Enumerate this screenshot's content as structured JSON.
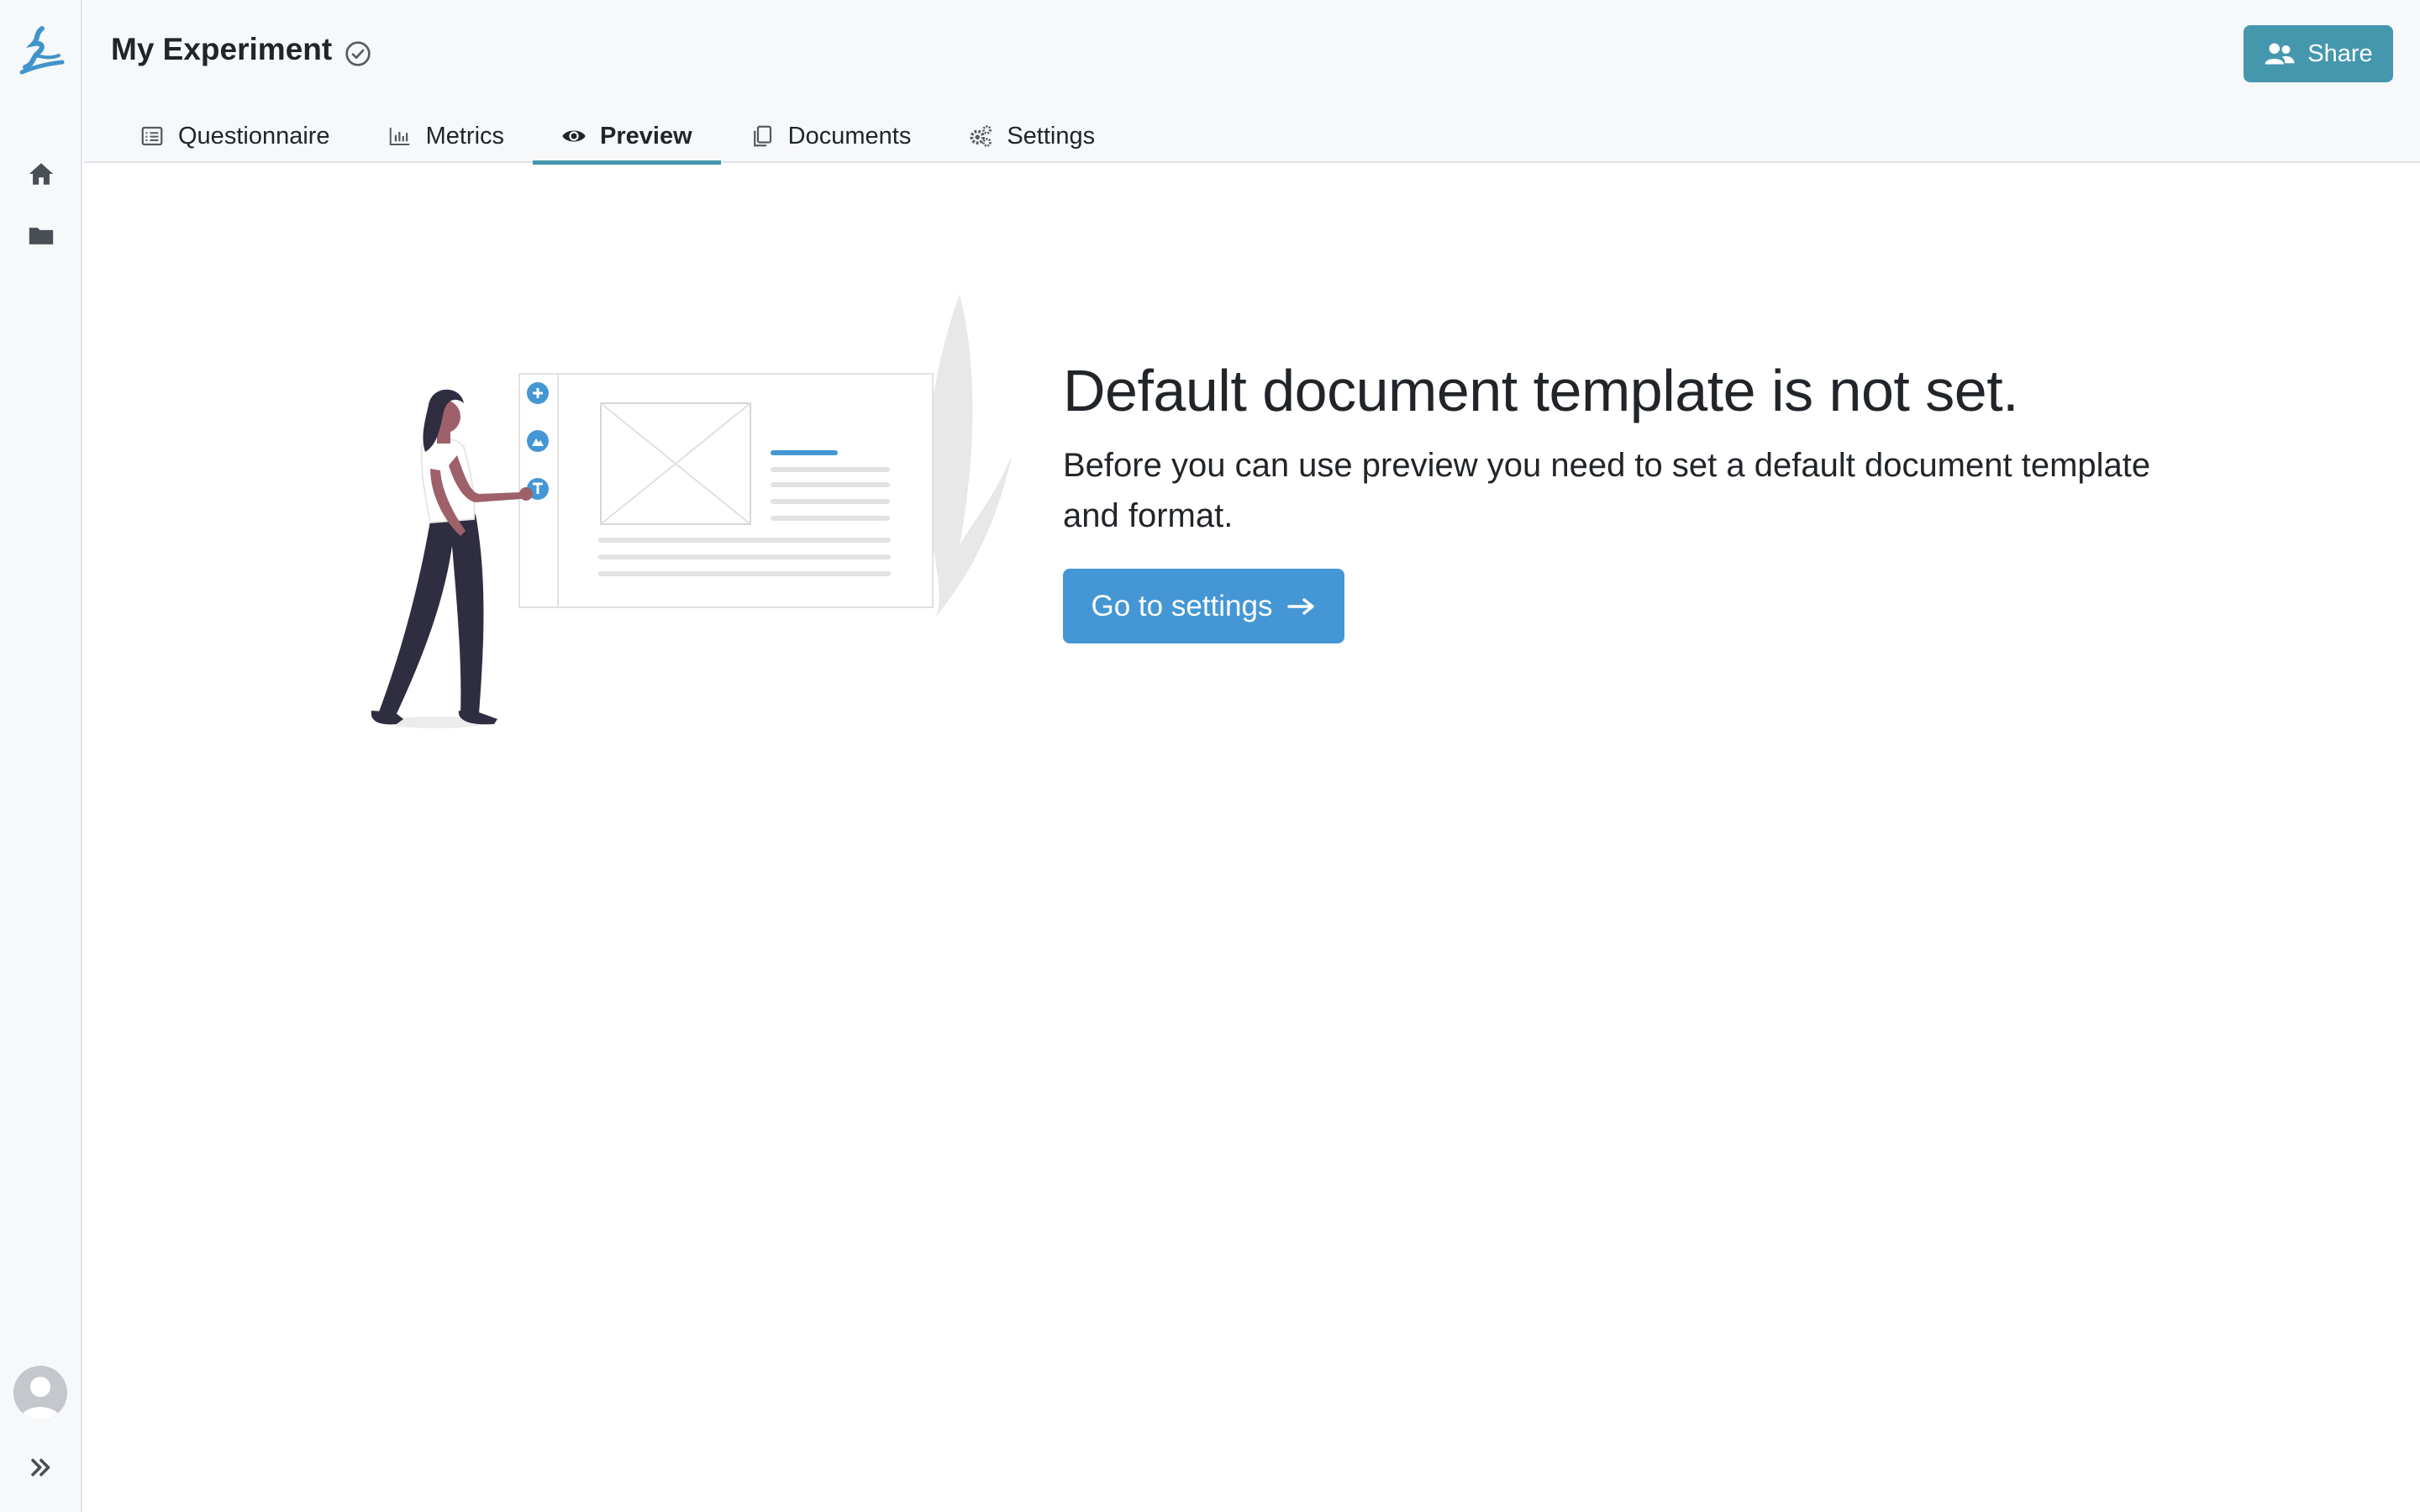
{
  "app": {
    "logo_icon": "ds-wizard-logo-icon",
    "accent_color": "#4597ad",
    "primary_button_color": "#4497d4"
  },
  "sidebar": {
    "items": [
      {
        "name": "home",
        "icon": "home-icon"
      },
      {
        "name": "projects",
        "icon": "folder-icon"
      }
    ],
    "avatar_icon": "user-avatar-icon",
    "expand_icon": "double-chevron-right-icon"
  },
  "header": {
    "title": "My Experiment",
    "status_icon": "check-circle-icon",
    "share_label": "Share",
    "share_icon": "users-icon",
    "tabs": [
      {
        "label": "Questionnaire",
        "icon": "list-icon",
        "active": false
      },
      {
        "label": "Metrics",
        "icon": "bar-chart-icon",
        "active": false
      },
      {
        "label": "Preview",
        "icon": "eye-icon",
        "active": true
      },
      {
        "label": "Documents",
        "icon": "copy-icon",
        "active": false
      },
      {
        "label": "Settings",
        "icon": "gears-icon",
        "active": false
      }
    ]
  },
  "main": {
    "illustration": "person-editing-document-illustration",
    "message_title": "Default document template is not set.",
    "message_body": "Before you can use preview you need to set a default document template and format.",
    "button_label": "Go to settings",
    "button_icon": "arrow-right-icon"
  }
}
